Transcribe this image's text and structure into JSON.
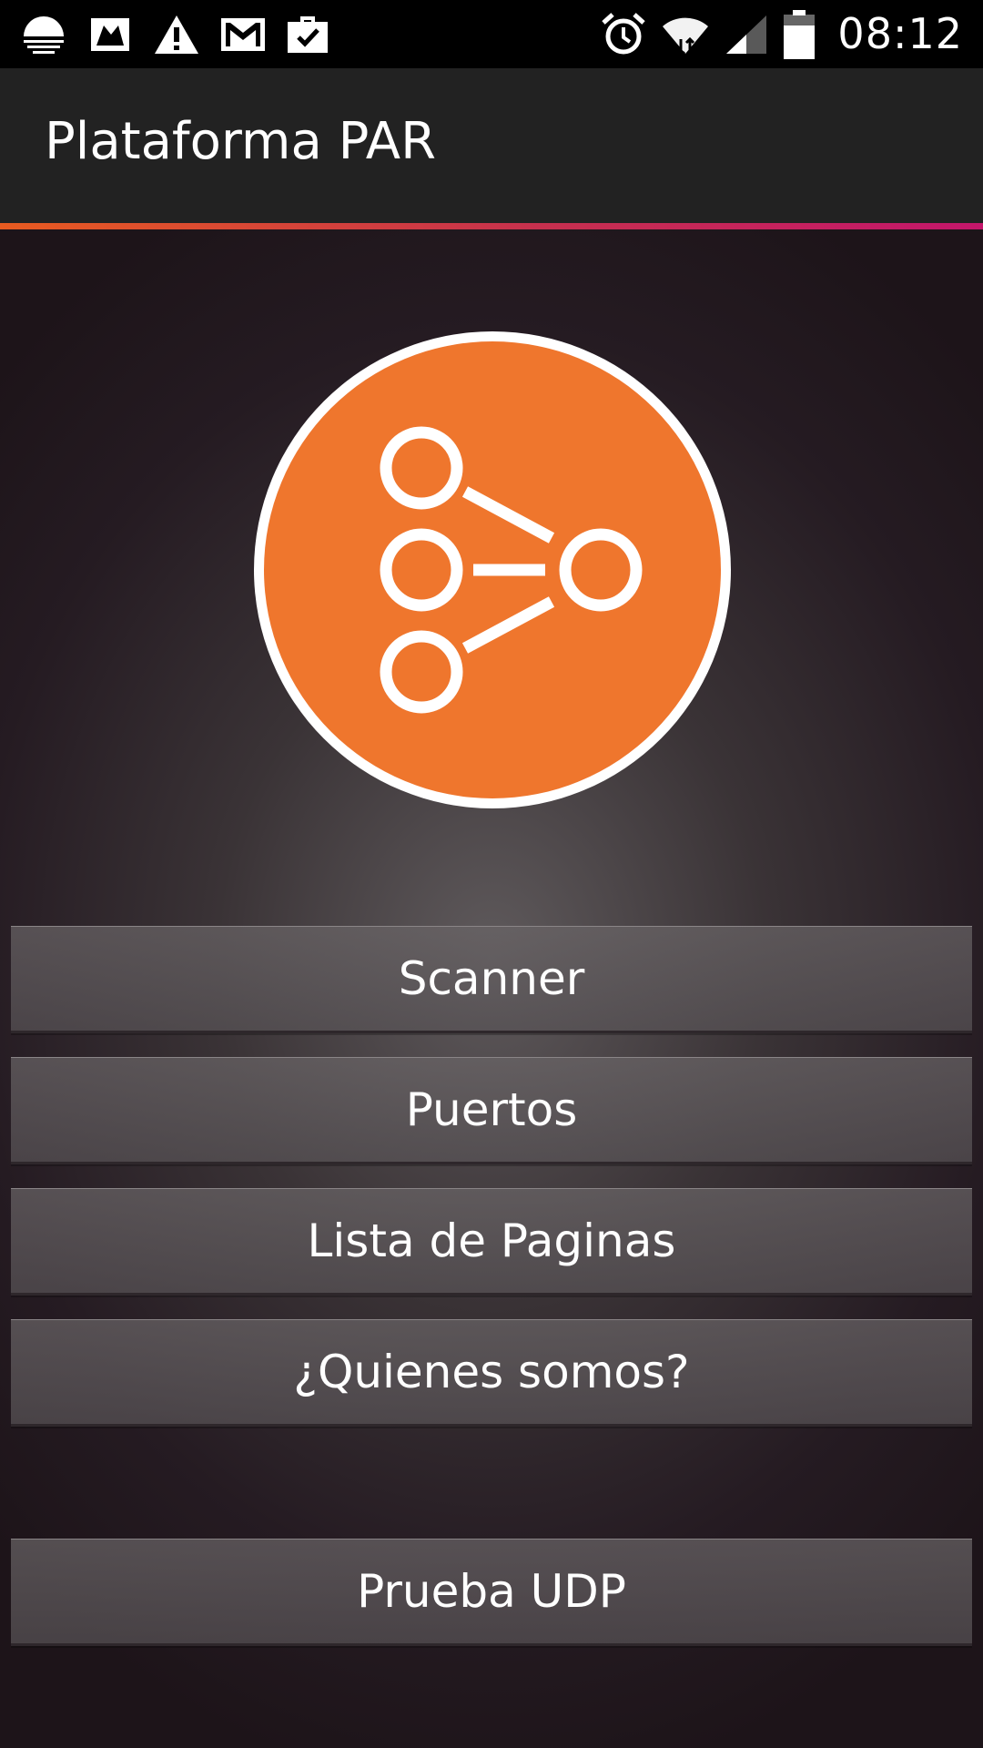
{
  "status_bar": {
    "time": "08:12",
    "left_icons": [
      "sunset-weather-icon",
      "photo-frame-icon",
      "warning-icon",
      "gmail-icon",
      "briefcase-check-icon"
    ],
    "right_icons": [
      "alarm-clock-icon",
      "wifi-icon",
      "cell-signal-icon",
      "battery-icon"
    ]
  },
  "action_bar": {
    "title": "Plataforma PAR"
  },
  "logo": {
    "icon": "share-nodes-icon",
    "circle_color": "#EF762D",
    "ring_color": "#FFFFFF"
  },
  "buttons": {
    "scanner": "Scanner",
    "puertos": "Puertos",
    "lista_paginas": "Lista de Paginas",
    "quienes_somos": "¿Quienes somos?",
    "prueba_udp": "Prueba UDP"
  },
  "colors": {
    "accent_gradient_start": "#E85B20",
    "accent_gradient_end": "#C4166B",
    "action_bar_bg": "#222222",
    "status_bar_bg": "#000000"
  }
}
